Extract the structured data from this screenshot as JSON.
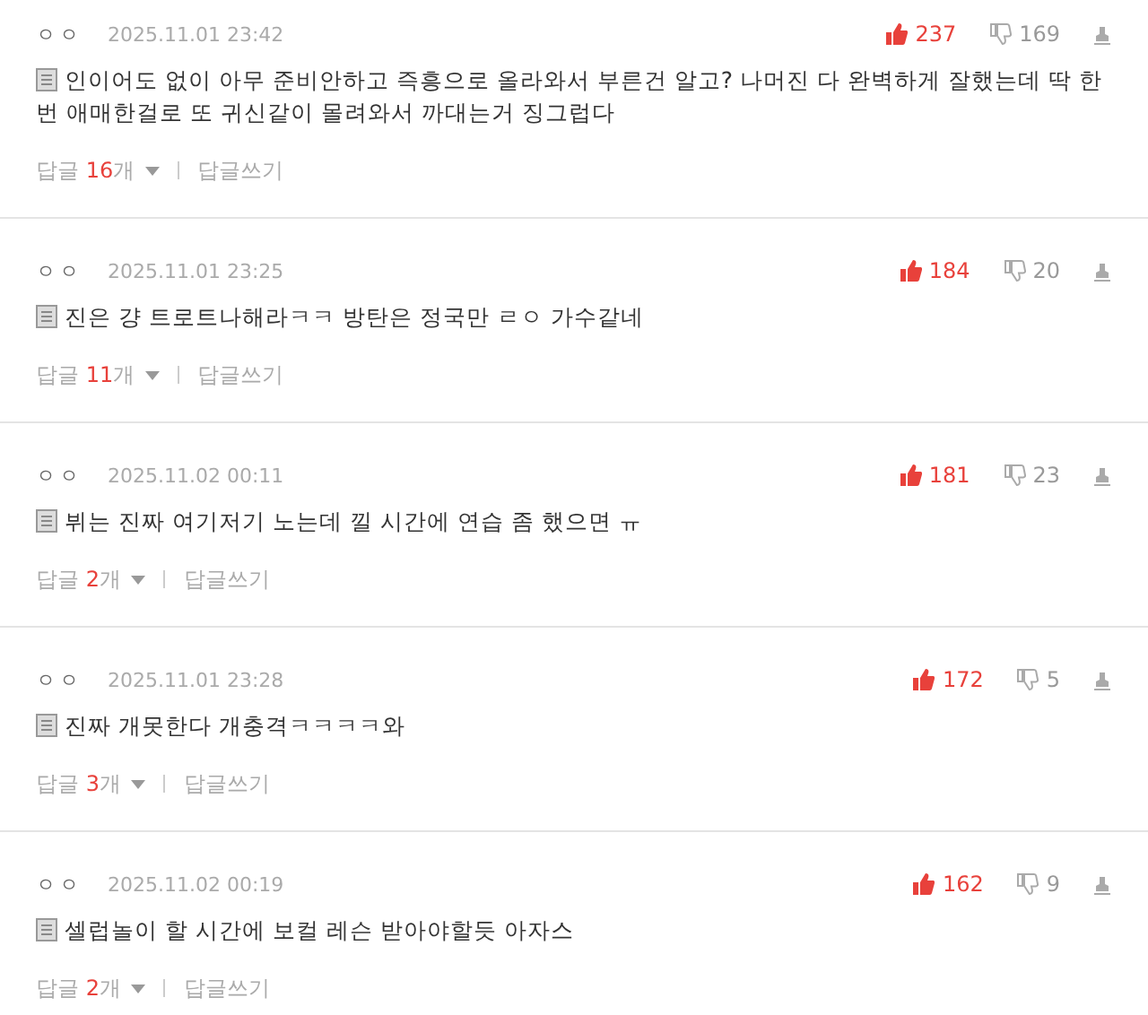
{
  "comments": [
    {
      "author": "ㅇㅇ",
      "date": "2025.11.01 23:42",
      "likes": "237",
      "dislikes": "169",
      "text": "인이어도 없이 아무 준비안하고 즉흥으로 올라와서 부른건 알고? 나머진 다 완벽하게 잘했는데 딱 한번 애매한걸로 또 귀신같이 몰려와서 까대는거 징그럽다",
      "reply_label": "답글",
      "reply_count": "16",
      "reply_unit": "개",
      "write_reply": "답글쓰기"
    },
    {
      "author": "ㅇㅇ",
      "date": "2025.11.01 23:25",
      "likes": "184",
      "dislikes": "20",
      "text": "진은 걍 트로트나해라ㅋㅋ 방탄은 정국만 ㄹㅇ 가수같네",
      "reply_label": "답글",
      "reply_count": "11",
      "reply_unit": "개",
      "write_reply": "답글쓰기"
    },
    {
      "author": "ㅇㅇ",
      "date": "2025.11.02 00:11",
      "likes": "181",
      "dislikes": "23",
      "text": "뷔는 진짜 여기저기 노는데 낄 시간에 연습 좀 했으면 ㅠ",
      "reply_label": "답글",
      "reply_count": "2",
      "reply_unit": "개",
      "write_reply": "답글쓰기"
    },
    {
      "author": "ㅇㅇ",
      "date": "2025.11.01 23:28",
      "likes": "172",
      "dislikes": "5",
      "text": "진짜 개못한다 개충격ㅋㅋㅋㅋ와",
      "reply_label": "답글",
      "reply_count": "3",
      "reply_unit": "개",
      "write_reply": "답글쓰기"
    },
    {
      "author": "ㅇㅇ",
      "date": "2025.11.02 00:19",
      "likes": "162",
      "dislikes": "9",
      "text": "셀럽놀이 할 시간에 보컬 레슨 받아야할듯 아자스",
      "reply_label": "답글",
      "reply_count": "2",
      "reply_unit": "개",
      "write_reply": "답글쓰기"
    }
  ]
}
